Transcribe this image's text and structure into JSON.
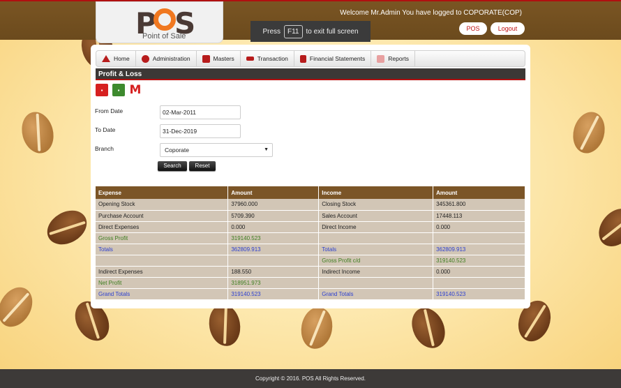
{
  "header": {
    "logo_text_p": "P",
    "logo_text_s": "S",
    "logo_subtitle": "Point of Sale",
    "fullscreen_press": "Press",
    "fullscreen_key": "F11",
    "fullscreen_suffix": "to exit full screen",
    "welcome": "Welcome Mr.Admin You have logged to COPORATE(COP)",
    "pos_button": "POS",
    "logout_button": "Logout"
  },
  "nav": {
    "items": [
      {
        "label": "Home"
      },
      {
        "label": "Administration"
      },
      {
        "label": "Masters"
      },
      {
        "label": "Transaction"
      },
      {
        "label": "Financial Statements"
      },
      {
        "label": "Reports"
      }
    ]
  },
  "page": {
    "title": "Profit & Loss"
  },
  "form": {
    "from_label": "From Date",
    "from_value": "02-Mar-2011",
    "to_label": "To Date",
    "to_value": "31-Dec-2019",
    "branch_label": "Branch",
    "branch_value": "Coporate",
    "search_label": "Search",
    "reset_label": "Reset"
  },
  "table": {
    "headers": [
      "Expense",
      "Amount",
      "Income",
      "Amount"
    ],
    "rows": [
      {
        "expense": "Opening Stock",
        "exp_amount": "37960.000",
        "income": "Closing Stock",
        "inc_amount": "345361.800"
      },
      {
        "expense": "Purchase Account",
        "exp_amount": "5709.390",
        "income": "Sales Account",
        "inc_amount": "17448.113"
      },
      {
        "expense": "Direct Expenses",
        "exp_amount": "0.000",
        "income": "Direct Income",
        "inc_amount": "0.000"
      },
      {
        "expense": "Gross Profit",
        "exp_amount": "319140.523",
        "income": "",
        "inc_amount": ""
      },
      {
        "expense": "Totals",
        "exp_amount": "362809.913",
        "income": "Totals",
        "inc_amount": "362809.913"
      },
      {
        "expense": "",
        "exp_amount": "",
        "income": "Gross Profit c/d",
        "inc_amount": "319140.523"
      },
      {
        "expense": "Indirect Expenses",
        "exp_amount": "188.550",
        "income": "Indirect Income",
        "inc_amount": "0.000"
      },
      {
        "expense": "Net Profit",
        "exp_amount": "318951.973",
        "income": "",
        "inc_amount": ""
      },
      {
        "expense": "Grand Totals",
        "exp_amount": "319140.523",
        "income": "Grand Totals",
        "inc_amount": "319140.523"
      }
    ]
  },
  "footer": {
    "text": "Copyright © 2016. POS All Rights Reserved."
  },
  "colors": {
    "header_brown": "#6b4a1d",
    "table_header": "#7b5527",
    "accent_red": "#b01010",
    "green_text": "#3d7d1f",
    "blue_text": "#2b3fd0"
  }
}
